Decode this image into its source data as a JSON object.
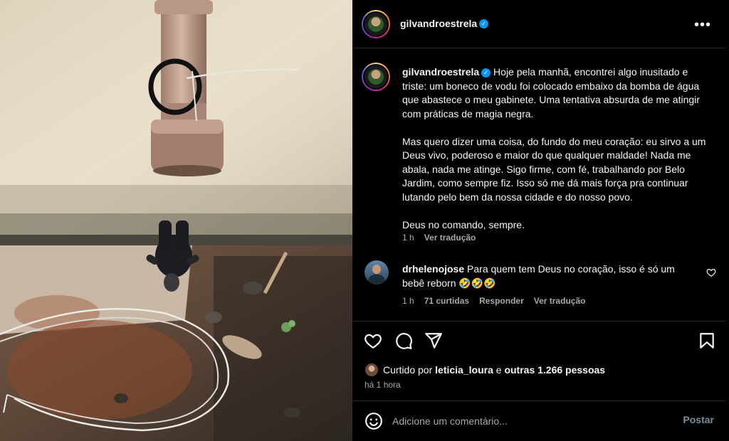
{
  "post": {
    "author": "gilvandroestrela",
    "caption_paragraphs": [
      "Hoje pela manhã, encontrei algo inusitado e triste: um boneco de vodu foi colocado embaixo da bomba de água que abastece o meu gabinete. Uma tentativa absurda de me atingir com práticas de magia negra.",
      "Mas quero dizer uma coisa, do fundo do meu coração: eu sirvo a um Deus vivo, poderoso e maior do que qualquer maldade! Nada me abala, nada me atinge. Sigo firme, com fé, trabalhando por Belo Jardim, como sempre fiz. Isso só me dá mais força pra continuar lutando pelo bem da nossa cidade e do nosso povo.",
      "Deus no comando, sempre."
    ],
    "caption_time": "1 h",
    "translate_label": "Ver tradução",
    "more_label": "•••"
  },
  "comment": {
    "author": "drhelenojose",
    "text": "Para quem tem Deus no coração, isso é só um bebê reborn 🤣🤣🤣",
    "time": "1 h",
    "likes": "71 curtidas",
    "reply_label": "Responder",
    "translate_label": "Ver tradução"
  },
  "likes": {
    "prefix": "Curtido por",
    "liker": "leticia_loura",
    "middle": "e",
    "others": "outras 1.266 pessoas"
  },
  "time_ago": "há 1 hora",
  "comment_input": {
    "placeholder": "Adicione um comentário...",
    "post_label": "Postar"
  },
  "icons": {
    "like": "heart-icon",
    "comment": "comment-icon",
    "share": "share-icon",
    "save": "bookmark-icon",
    "emoji": "emoji-icon",
    "verified": "verified-badge-icon",
    "more": "more-options-icon"
  },
  "colors": {
    "background": "#000000",
    "text": "#f5f5f5",
    "muted": "#a8a8a8",
    "verified": "#0095f6",
    "post_button": "#7a8ea0"
  }
}
